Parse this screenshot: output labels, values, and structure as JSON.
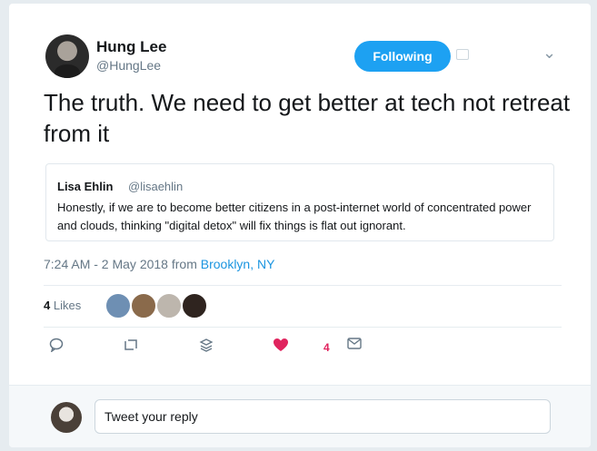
{
  "author": {
    "name": "Hung Lee",
    "handle": "@HungLee"
  },
  "follow_button": "Following",
  "tweet_text": "The truth. We need to get better at tech not retreat from it",
  "quote": {
    "name": "Lisa Ehlin",
    "handle": "@lisaehlin",
    "text": "Honestly, if we are to become better citizens in a post-internet world of concentrated power and clouds, thinking \"digital detox\" will fix things is flat out ignorant."
  },
  "meta": {
    "timestamp": "7:24 AM - 2 May 2018 from",
    "location": "Brooklyn, NY"
  },
  "likes": {
    "count": "4",
    "label": "Likes"
  },
  "actions": {
    "like_count": "4"
  },
  "reply": {
    "placeholder": "Tweet your reply"
  },
  "colors": {
    "accent": "#1da1f2",
    "like": "#e0245e",
    "link": "#1b95e0"
  },
  "icons": [
    "caret-down-icon",
    "reply-icon",
    "retweet-icon",
    "stack-icon",
    "heart-icon",
    "mail-icon"
  ]
}
